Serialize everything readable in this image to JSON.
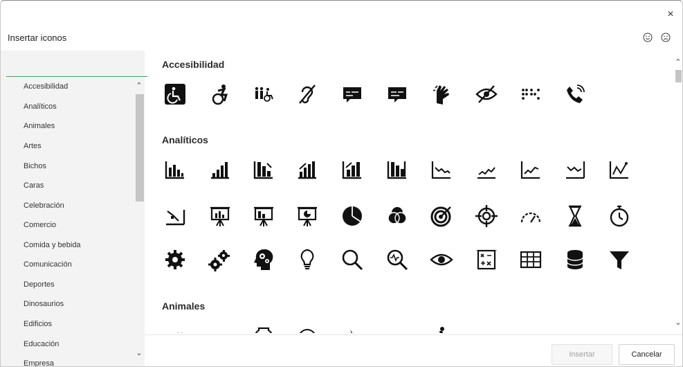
{
  "dialog": {
    "title": "Insertar iconos",
    "close_glyph": "×",
    "feedback_icons": [
      "smile-icon",
      "frown-icon"
    ]
  },
  "sidebar": {
    "search_value": "",
    "categories": [
      "Accesibilidad",
      "Analíticos",
      "Animales",
      "Artes",
      "Bichos",
      "Caras",
      "Celebración",
      "Comercio",
      "Comida y bebida",
      "Comunicación",
      "Deportes",
      "Dinosaurios",
      "Edificios",
      "Educación",
      "Empresa"
    ]
  },
  "sections": [
    {
      "label": "Accesibilidad",
      "icons": [
        "wheelchair-square-icon",
        "active-wheelchair-icon",
        "accessible-family-icon",
        "hearing-loss-icon",
        "closed-caption-bubble-icon",
        "sign-language-bubble-icon",
        "sign-language-hands-icon",
        "visually-impaired-icon",
        "braille-icon",
        "tty-phone-icon"
      ]
    },
    {
      "label": "Analíticos",
      "icons": [
        "bar-chart-icon",
        "bar-chart-ascending-icon",
        "bar-chart-descending-icon",
        "bar-chart-up-arrow-icon",
        "bar-chart-up-box-icon",
        "bar-chart-down-box-icon",
        "line-chart-down-icon",
        "line-chart-zigzag-icon",
        "line-chart-up-icon",
        "line-chart-wave-icon",
        "line-chart-scatter-icon",
        "scatter-trend-icon",
        "presentation-bar-icon",
        "presentation-column-icon",
        "presentation-pie-icon",
        "pie-chart-icon",
        "venn-diagram-icon",
        "target-icon",
        "crosshair-icon",
        "gauge-icon",
        "hourglass-icon",
        "stopwatch-icon",
        "gear-icon",
        "gears-icon",
        "head-gears-icon",
        "lightbulb-icon",
        "magnifier-icon",
        "health-search-icon",
        "eye-icon",
        "formula-box-icon",
        "table-grid-icon",
        "database-icon",
        "filter-icon"
      ]
    },
    {
      "label": "Animales",
      "icons": [
        "cat-icon",
        "dog-icon",
        "fishbowl-icon",
        "hamster-icon",
        "rabbit-icon",
        "snail-icon",
        "snake-icon",
        "turtle-icon",
        "bird-icon",
        "crocodile-icon",
        "bat-icon"
      ]
    }
  ],
  "buttons": {
    "insert": "Insertar",
    "cancel": "Cancelar"
  }
}
